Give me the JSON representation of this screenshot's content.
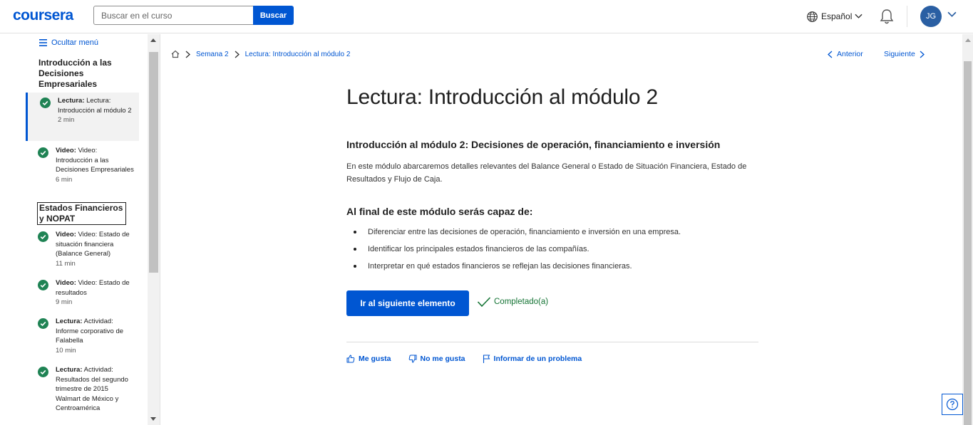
{
  "header": {
    "logo": "coursera",
    "search_placeholder": "Buscar en el curso",
    "search_button": "Buscar",
    "language": "Español",
    "avatar_initials": "JG"
  },
  "sidebar": {
    "hide_menu": "Ocultar menú",
    "sections": [
      {
        "title": "Introducción a las Decisiones Empresariales"
      },
      {
        "title": "Estados Financieros y NOPAT"
      }
    ],
    "items": [
      {
        "type": "Lectura:",
        "label": "Lectura: Introducción al módulo 2",
        "duration": "2 min"
      },
      {
        "type": "Video:",
        "label": "Video: Introducción a las Decisiones Empresariales",
        "duration": "6 min"
      },
      {
        "type": "Video:",
        "label": "Video: Estado de situación financiera (Balance General)",
        "duration": "11 min"
      },
      {
        "type": "Video:",
        "label": "Video: Estado de resultados",
        "duration": "9 min"
      },
      {
        "type": "Lectura:",
        "label": "Actividad: Informe corporativo de Falabella",
        "duration": "10 min"
      },
      {
        "type": "Lectura:",
        "label": "Actividad: Resultados del segundo trimestre de 2015 Walmart de México y Centroamérica",
        "duration": ""
      }
    ]
  },
  "breadcrumb": {
    "week": "Semana 2",
    "current": "Lectura: Introducción al módulo 2"
  },
  "nav": {
    "prev": "Anterior",
    "next": "Siguiente"
  },
  "main": {
    "title": "Lectura: Introducción al módulo 2",
    "subheading": "Introducción al módulo 2: Decisiones de operación, financiamiento e inversión",
    "paragraph": "En este módulo abarcaremos detalles relevantes del Balance General o Estado de Situación Financiera, Estado de Resultados y Flujo de Caja.",
    "goals_heading": "Al final de este módulo serás capaz de:",
    "goals": [
      "Diferenciar entre las decisiones de operación, financiamiento e inversión en una empresa.",
      "Identificar los principales estados financieros de las compañías.",
      "Interpretar en qué estados financieros se reflejan las decisiones financieras."
    ],
    "next_button": "Ir al siguiente elemento",
    "completed": "Completado(a)",
    "feedback": {
      "like": "Me gusta",
      "dislike": "No me gusta",
      "report": "Informar de un problema"
    }
  },
  "colors": {
    "accent": "#0056d2",
    "success": "#137333"
  }
}
